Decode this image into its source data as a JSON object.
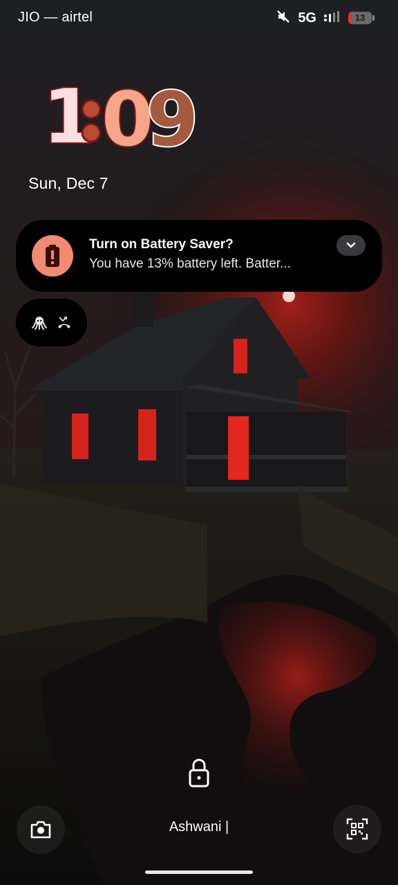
{
  "status_bar": {
    "carrier": "JIO — airtel",
    "network_type": "5G",
    "battery_level": "13",
    "battery_percent": 13,
    "icons": [
      "mute-icon",
      "signal-icon",
      "battery-icon"
    ]
  },
  "lock_screen": {
    "clock": {
      "hour": "1",
      "minute_tens": "0",
      "minute_ones": "9",
      "separator": ":",
      "colors": {
        "hour": "#f9e1e1",
        "separator": "#b84a36",
        "minute_tens": "#f4a58a",
        "minute_ones": "#a55a3f",
        "outline": "#7a1414"
      }
    },
    "date": "Sun, Dec 7",
    "owner_info": "Ashwani |"
  },
  "notification": {
    "title": "Turn on Battery Saver?",
    "body": "You have 13% battery left. Batter...",
    "icon": "battery-alert-icon",
    "accent_color": "#f08a72"
  },
  "notification_shelf": {
    "icons": [
      "octopus-icon",
      "missed-call-icon"
    ]
  },
  "shortcuts": {
    "left_icon": "camera-icon",
    "right_icon": "qr-scanner-icon"
  }
}
